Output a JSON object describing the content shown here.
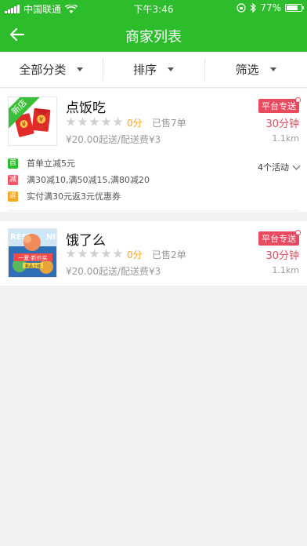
{
  "status_bar": {
    "carrier": "中国联通",
    "time": "下午3:46",
    "battery": "77%",
    "battery_level": 0.77
  },
  "nav": {
    "title": "商家列表"
  },
  "filters": [
    {
      "label": "全部分类"
    },
    {
      "label": "排序"
    },
    {
      "label": "筛选"
    }
  ],
  "shops": [
    {
      "name": "点饭吃",
      "new_label": "新店",
      "score": "0分",
      "sold": "已售7单",
      "fees": "¥20.00起送/配送费¥3",
      "delivery_tag": "平台专送",
      "time": "30分钟",
      "distance": "1.1km",
      "activities_count": "4个活动",
      "promos": [
        {
          "badge": "首",
          "color": "#2cbc2c",
          "text": "首单立减5元"
        },
        {
          "badge": "减",
          "color": "#f2566b",
          "text": "满30减10,满50减15,满80减20"
        },
        {
          "badge": "返",
          "color": "#f5a623",
          "text": "实付满30元返3元优惠券"
        }
      ]
    },
    {
      "name": "饿了么",
      "score": "0分",
      "sold": "已售2单",
      "fees": "¥20.00起送/配送费¥3",
      "delivery_tag": "平台专送",
      "time": "30分钟",
      "distance": "1.1km",
      "thumb_text": {
        "left": "RESH",
        "right": "NI",
        "banner": "一夏·新价实",
        "sub": "新品上线"
      }
    }
  ]
}
